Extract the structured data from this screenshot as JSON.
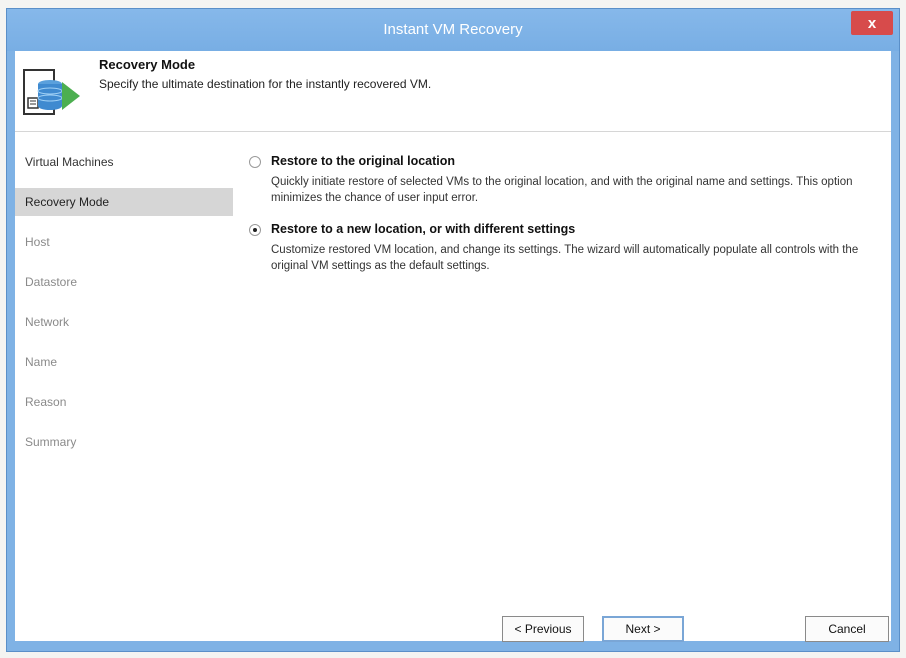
{
  "window": {
    "title": "Instant VM Recovery",
    "close_glyph": "x"
  },
  "header": {
    "title": "Recovery Mode",
    "subtitle": "Specify the ultimate destination for the instantly recovered VM.",
    "icon": "recovery-wizard-icon"
  },
  "nav": {
    "items": [
      {
        "label": "Virtual Machines",
        "state": "enabled"
      },
      {
        "label": "Recovery Mode",
        "state": "active"
      },
      {
        "label": "Host",
        "state": "disabled"
      },
      {
        "label": "Datastore",
        "state": "disabled"
      },
      {
        "label": "Network",
        "state": "disabled"
      },
      {
        "label": "Name",
        "state": "disabled"
      },
      {
        "label": "Reason",
        "state": "disabled"
      },
      {
        "label": "Summary",
        "state": "disabled"
      }
    ]
  },
  "options": [
    {
      "title": "Restore to the original location",
      "description": "Quickly initiate restore of selected VMs to the original location, and with the original name and settings. This option minimizes the chance of user input error.",
      "selected": false
    },
    {
      "title": "Restore to a new location, or with different settings",
      "description": "Customize restored VM location, and change its settings. The wizard will automatically populate all controls with the original VM settings as the default settings.",
      "selected": true
    }
  ],
  "buttons": {
    "previous": "< Previous",
    "next": "Next >",
    "cancel": "Cancel"
  },
  "colors": {
    "titlebar": "#7fb2e5",
    "close": "#d74b4b",
    "nav_active": "#d6d6d6"
  }
}
